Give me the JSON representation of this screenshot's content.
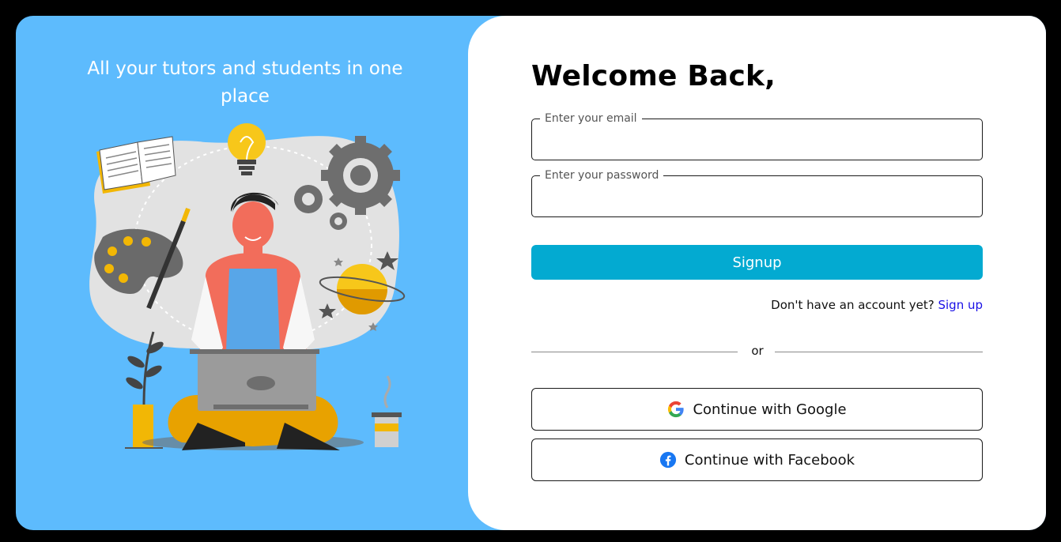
{
  "left": {
    "tagline": "All your tutors and students in one place"
  },
  "form": {
    "title": "Welcome Back,",
    "email_label": "Enter your email",
    "password_label": "Enter your password",
    "submit_label": "Signup",
    "no_account_text": "Don't have an account yet?",
    "signup_link": "Sign up",
    "divider_text": "or",
    "google_label": "Continue with Google",
    "facebook_label": "Continue with Facebook"
  },
  "colors": {
    "left_background": "#5dbbfd",
    "submit_button": "#03aad1",
    "link": "#1a10e6"
  },
  "icons": {
    "google": "google-g-icon",
    "facebook": "facebook-icon"
  }
}
